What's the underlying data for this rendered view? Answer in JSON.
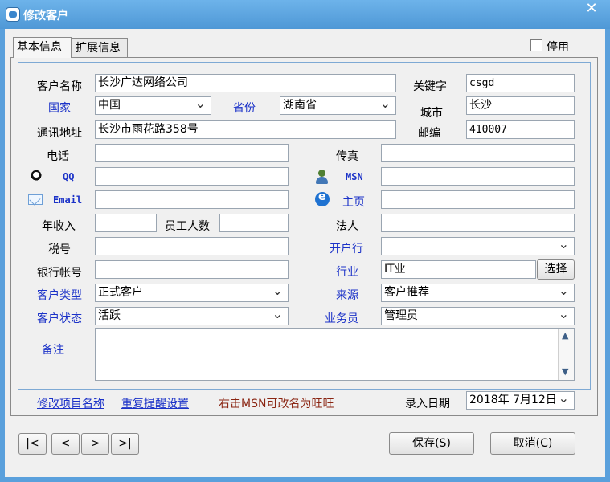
{
  "window": {
    "title": "修改客户",
    "close_glyph": "✕"
  },
  "tabs": [
    {
      "label": "基本信息"
    },
    {
      "label": "扩展信息"
    }
  ],
  "disable_label": "停用",
  "labels": {
    "customer_name": "客户名称",
    "keyword": "关键字",
    "country": "国家",
    "province": "省份",
    "city": "城市",
    "address": "通讯地址",
    "postcode": "邮编",
    "phone": "电话",
    "fax": "传真",
    "qq": "QQ",
    "msn": "MSN",
    "email": "Email",
    "homepage": "主页",
    "annual_income": "年收入",
    "employee_count": "员工人数",
    "legal_person": "法人",
    "tax_number": "税号",
    "bank": "开户行",
    "bank_account": "银行帐号",
    "industry": "行业",
    "customer_type": "客户类型",
    "source": "来源",
    "customer_status": "客户状态",
    "salesperson": "业务员",
    "remark": "备注",
    "entry_date": "录入日期"
  },
  "values": {
    "customer_name": "长沙广达网络公司",
    "keyword": "csgd",
    "country": "中国",
    "province": "湖南省",
    "city": "长沙",
    "address": "长沙市雨花路358号",
    "postcode": "410007",
    "industry": "IT业",
    "customer_type": "正式客户",
    "source": "客户推荐",
    "customer_status": "活跃",
    "salesperson": "管理员",
    "entry_date": "2018年  7月12日"
  },
  "buttons": {
    "choose": "选择",
    "save": "保存(S)",
    "cancel": "取消(C)"
  },
  "links": {
    "rename_items": "修改项目名称",
    "reminder_settings": "重复提醒设置",
    "msn_hint": "右击MSN可改名为旺旺"
  },
  "nav": {
    "first": "|<",
    "prev": "<",
    "next": ">",
    "last": ">|"
  }
}
